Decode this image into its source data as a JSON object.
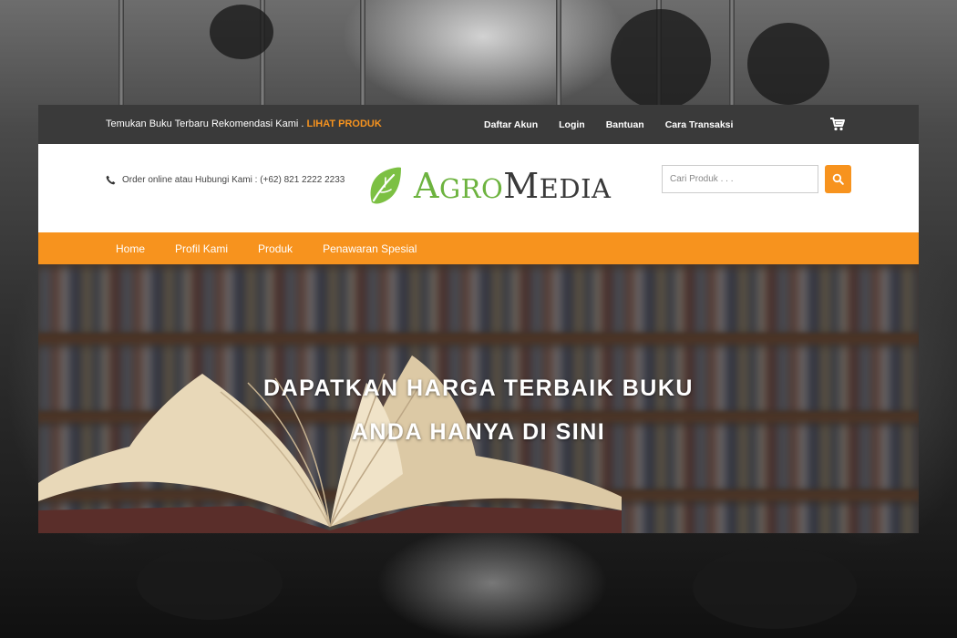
{
  "topbar": {
    "promo_text": "Temukan Buku Terbaru Rekomendasi Kami . ",
    "promo_link": "LIHAT PRODUK",
    "links": [
      "Daftar Akun",
      "Login",
      "Bantuan",
      "Cara Transaksi"
    ],
    "cart_icon": "cart-icon"
  },
  "header": {
    "contact_icon": "phone-icon",
    "contact_text": "Order online atau Hubungi Kami : (+62) 821 2222 2233",
    "logo": {
      "agro_first": "A",
      "agro_rest": "GRO",
      "media_first": "M",
      "media_rest": "EDIA"
    },
    "search": {
      "placeholder": "Cari Produk . . .",
      "button_icon": "search-icon"
    }
  },
  "nav": {
    "items": [
      "Home",
      "Profil Kami",
      "Produk",
      "Penawaran Spesial"
    ]
  },
  "hero": {
    "headline_line1": "DAPATKAN HARGA TERBAIK BUKU",
    "headline_line2": "ANDA HANYA DI SINI"
  },
  "colors": {
    "accent": "#f7931e",
    "topbar": "#3a3a3a",
    "logo_green": "#6db33f"
  }
}
